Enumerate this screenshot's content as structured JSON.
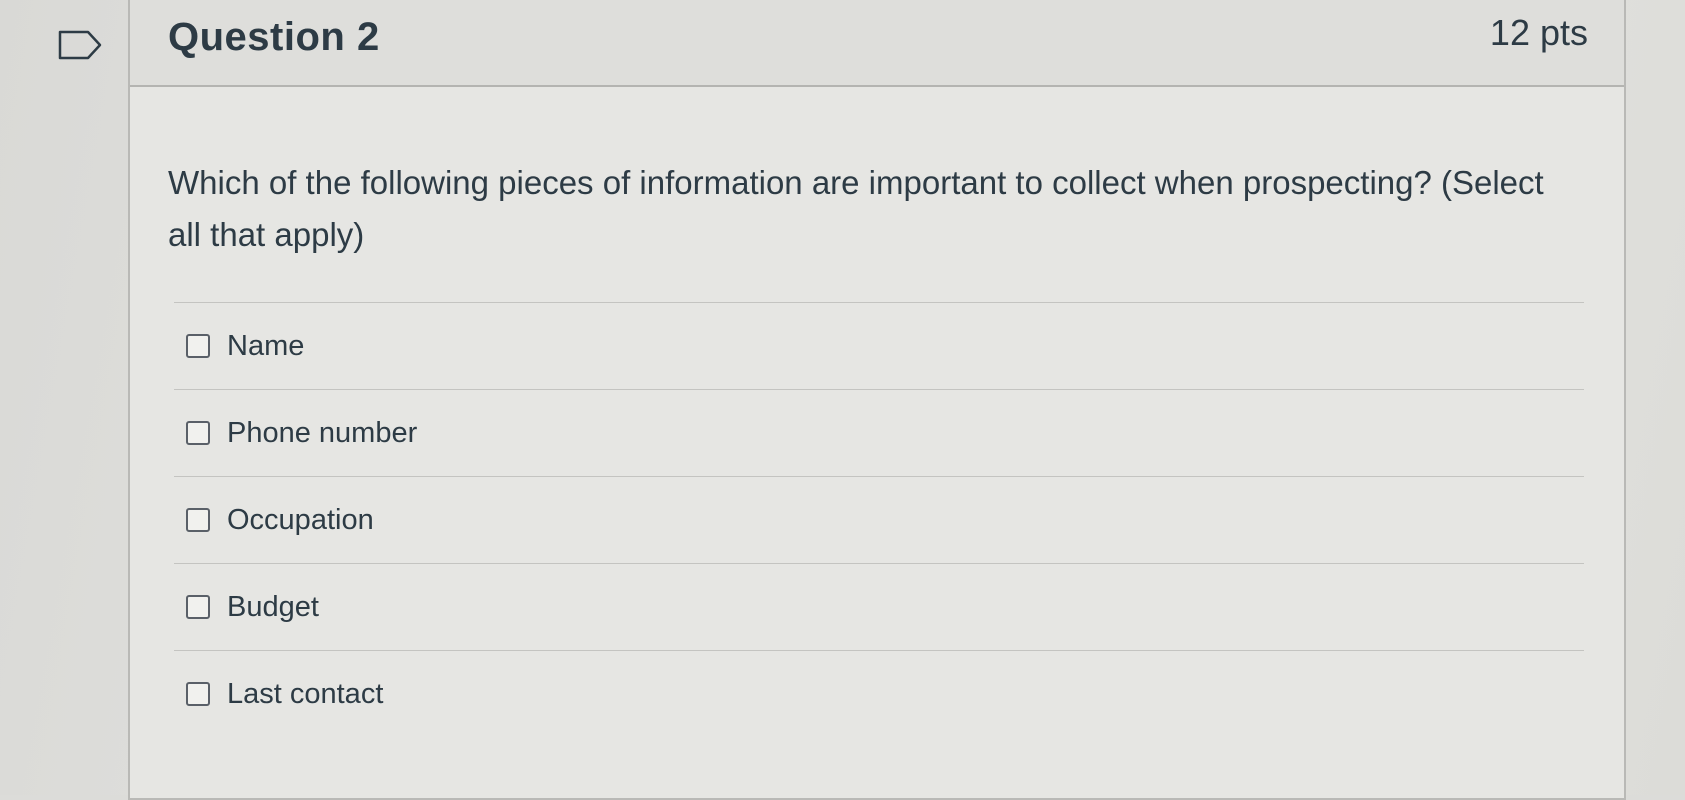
{
  "question": {
    "title": "Question 2",
    "points": "12 pts",
    "text": "Which of the following pieces of information are important to collect when prospecting? (Select all that apply)"
  },
  "answers": [
    {
      "label": "Name",
      "checked": false
    },
    {
      "label": "Phone number",
      "checked": false
    },
    {
      "label": "Occupation",
      "checked": false
    },
    {
      "label": "Budget",
      "checked": false
    },
    {
      "label": "Last contact",
      "checked": false
    }
  ],
  "icons": {
    "flag": "flag-question-icon"
  },
  "colors": {
    "text": "#2d3b45",
    "header_bg": "#dededb",
    "card_bg": "#e6e6e3",
    "border": "#b9b9b6"
  }
}
